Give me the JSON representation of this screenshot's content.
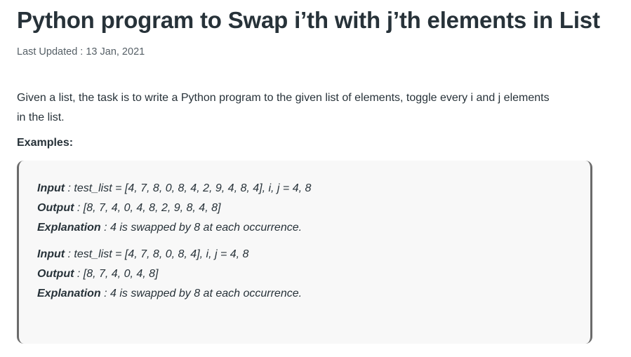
{
  "article": {
    "title": "Python program to Swap i’th with j’th elements in List",
    "last_updated": "Last Updated : 13 Jan, 2021",
    "intro_line1": "Given a list, the task is to write a Python program to the given list of elements, toggle every i and j elements",
    "intro_line2": "in the list.",
    "examples_heading": "Examples:"
  },
  "examples": [
    {
      "input_label": "Input",
      "input_value": " : test_list = [4, 7, 8, 0, 8, 4, 2, 9, 4, 8, 4], i, j = 4, 8",
      "output_label": "Output",
      "output_value": " : [8, 7, 4, 0, 4, 8, 2, 9, 8, 4, 8]",
      "explanation_label": "Explanation",
      "explanation_value": " : 4 is swapped by 8 at each occurrence."
    },
    {
      "input_label": "Input",
      "input_value": " : test_list = [4, 7, 8, 0, 8, 4], i, j = 4, 8",
      "output_label": "Output",
      "output_value": " : [8, 7, 4, 0, 4, 8]",
      "explanation_label": "Explanation",
      "explanation_value": " : 4 is swapped by 8 at each occurrence."
    }
  ]
}
